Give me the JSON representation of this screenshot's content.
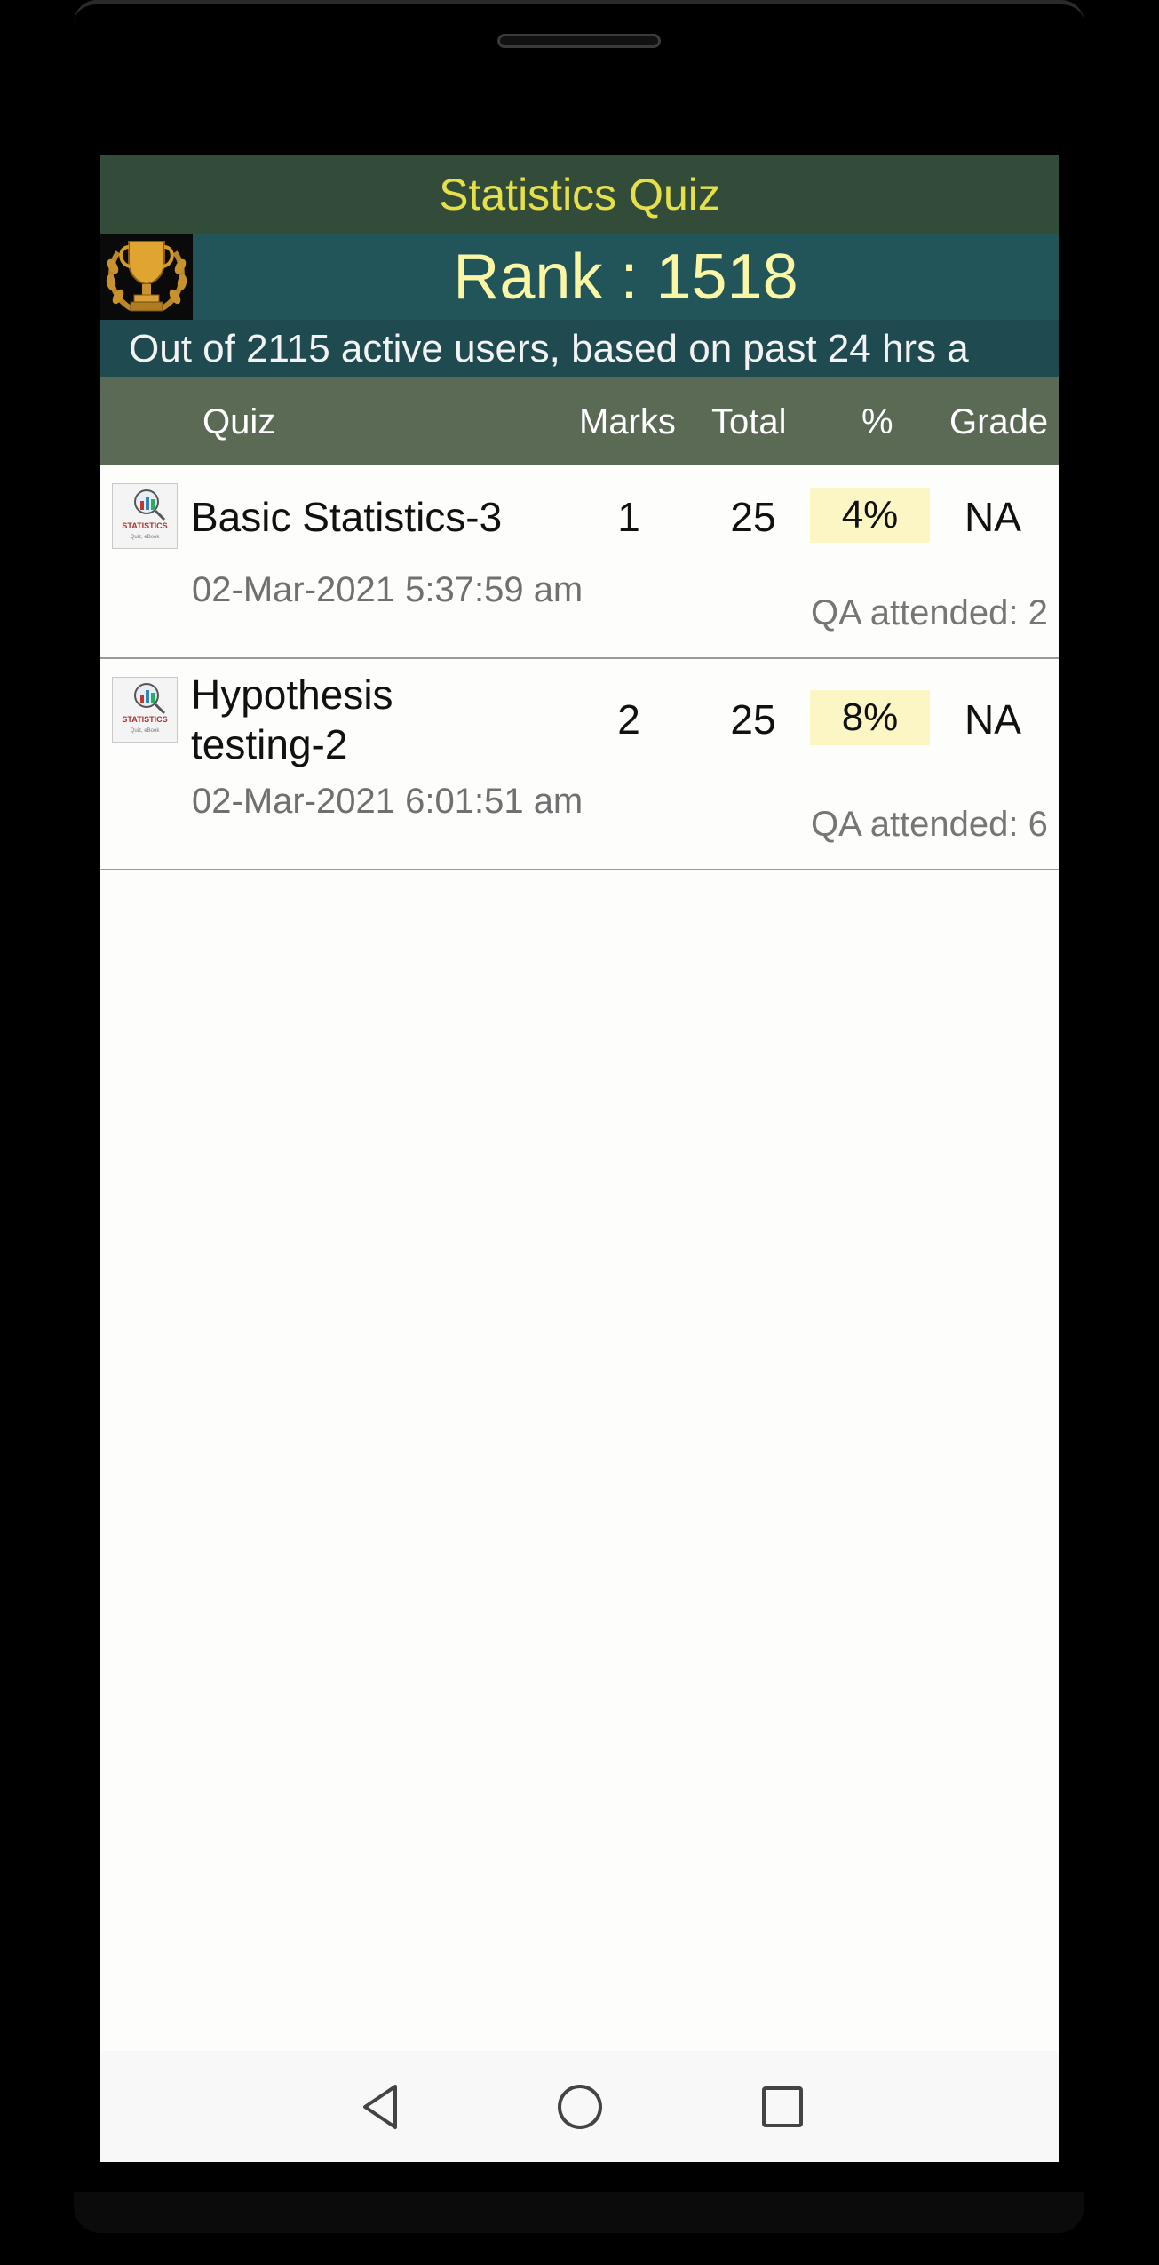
{
  "app": {
    "title": "Statistics Quiz",
    "rank_text": "Rank : 1518",
    "info_text": "Out of 2115 active users, based on past 24 hrs a"
  },
  "table": {
    "headers": {
      "quiz": "Quiz",
      "marks": "Marks",
      "total": "Total",
      "percent": "%",
      "grade": "Grade"
    },
    "rows": [
      {
        "name": "Basic Statistics-3",
        "date": "02-Mar-2021 5:37:59 am",
        "marks": "1",
        "total": "25",
        "percent": "4%",
        "grade": "NA",
        "qa": "QA attended: 2"
      },
      {
        "name_line1": "Hypothesis",
        "name_line2": "testing-2",
        "date": "02-Mar-2021 6:01:51 am",
        "marks": "2",
        "total": "25",
        "percent": "8%",
        "grade": "NA",
        "qa": "QA attended: 6"
      }
    ]
  },
  "thumbnail": {
    "label": "STATISTICS",
    "sublabel": "Quiz, eBook"
  },
  "navigation": {
    "back": "back-icon",
    "home": "home-icon",
    "recents": "recents-icon"
  },
  "colors": {
    "title_bar": "#334b39",
    "title_text": "#e5e04a",
    "rank_bar": "#22555a",
    "rank_text": "#fbf6a4",
    "header_row": "#5a6a55",
    "percent_highlight": "#fbf6c3"
  }
}
